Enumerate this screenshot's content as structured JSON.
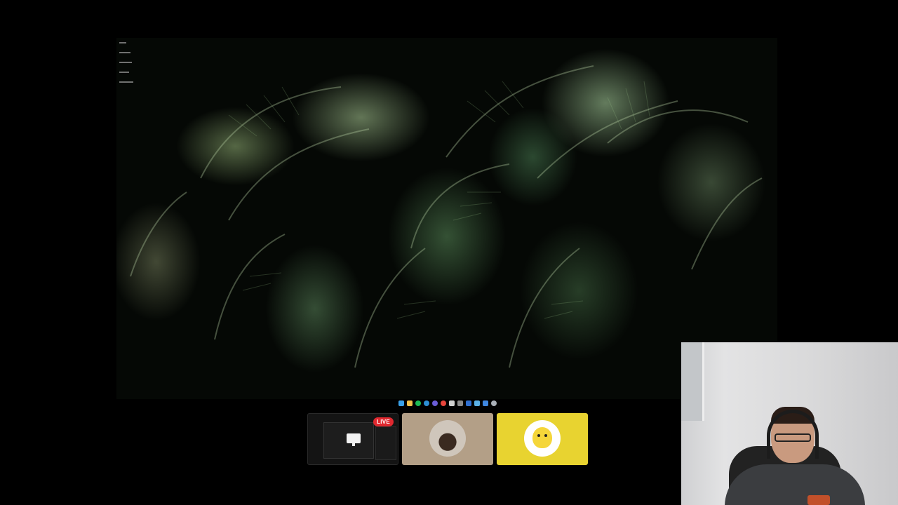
{
  "stream": {
    "live_badge": "LIVE"
  },
  "taskbar": {
    "icons": [
      {
        "name": "file-explorer-icon",
        "color": "#3aa0e8"
      },
      {
        "name": "folder-icon",
        "color": "#f2c04a"
      },
      {
        "name": "spotify-icon",
        "color": "#1db954"
      },
      {
        "name": "edge-icon",
        "color": "#2d8fd5"
      },
      {
        "name": "app-icon",
        "color": "#6a5cd6"
      },
      {
        "name": "chrome-icon",
        "color": "#e8453c"
      },
      {
        "name": "obs-icon",
        "color": "#d0d0d0"
      },
      {
        "name": "app-icon",
        "color": "#8a8a8a"
      },
      {
        "name": "app-icon",
        "color": "#2f6fd1"
      },
      {
        "name": "app-icon",
        "color": "#5ab0e6"
      },
      {
        "name": "app-icon",
        "color": "#3e86e0"
      },
      {
        "name": "settings-icon",
        "color": "#aab0b8"
      }
    ]
  },
  "colors": {
    "live_red": "#e0282f",
    "pikachu_yellow": "#e8d330",
    "avatar_tan": "#b39f87"
  }
}
